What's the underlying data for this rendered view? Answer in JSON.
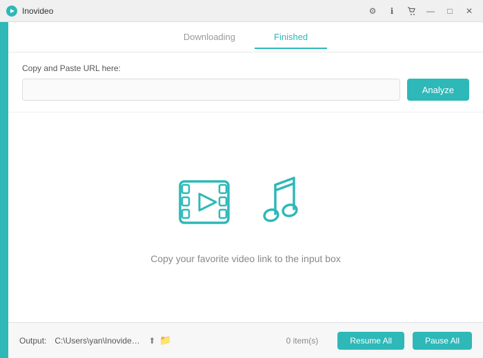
{
  "titlebar": {
    "app_name": "Inovideo",
    "controls": {
      "settings": "⚙",
      "info": "ℹ",
      "cart": "🛒",
      "minimize": "—",
      "maximize": "□",
      "close": "✕"
    }
  },
  "tabs": [
    {
      "id": "downloading",
      "label": "Downloading",
      "active": false
    },
    {
      "id": "finished",
      "label": "Finished",
      "active": true
    }
  ],
  "url_section": {
    "label": "Copy and Paste URL here:",
    "input_placeholder": "",
    "analyze_button": "Analyze"
  },
  "illustration": {
    "caption": "Copy your favorite video link to the input box"
  },
  "bottom_bar": {
    "output_label": "Output:",
    "output_path": "C:\\Users\\yan\\Inovideo\\D...",
    "items_count": "0 item(s)",
    "resume_all": "Resume All",
    "pause_all": "Pause All"
  }
}
